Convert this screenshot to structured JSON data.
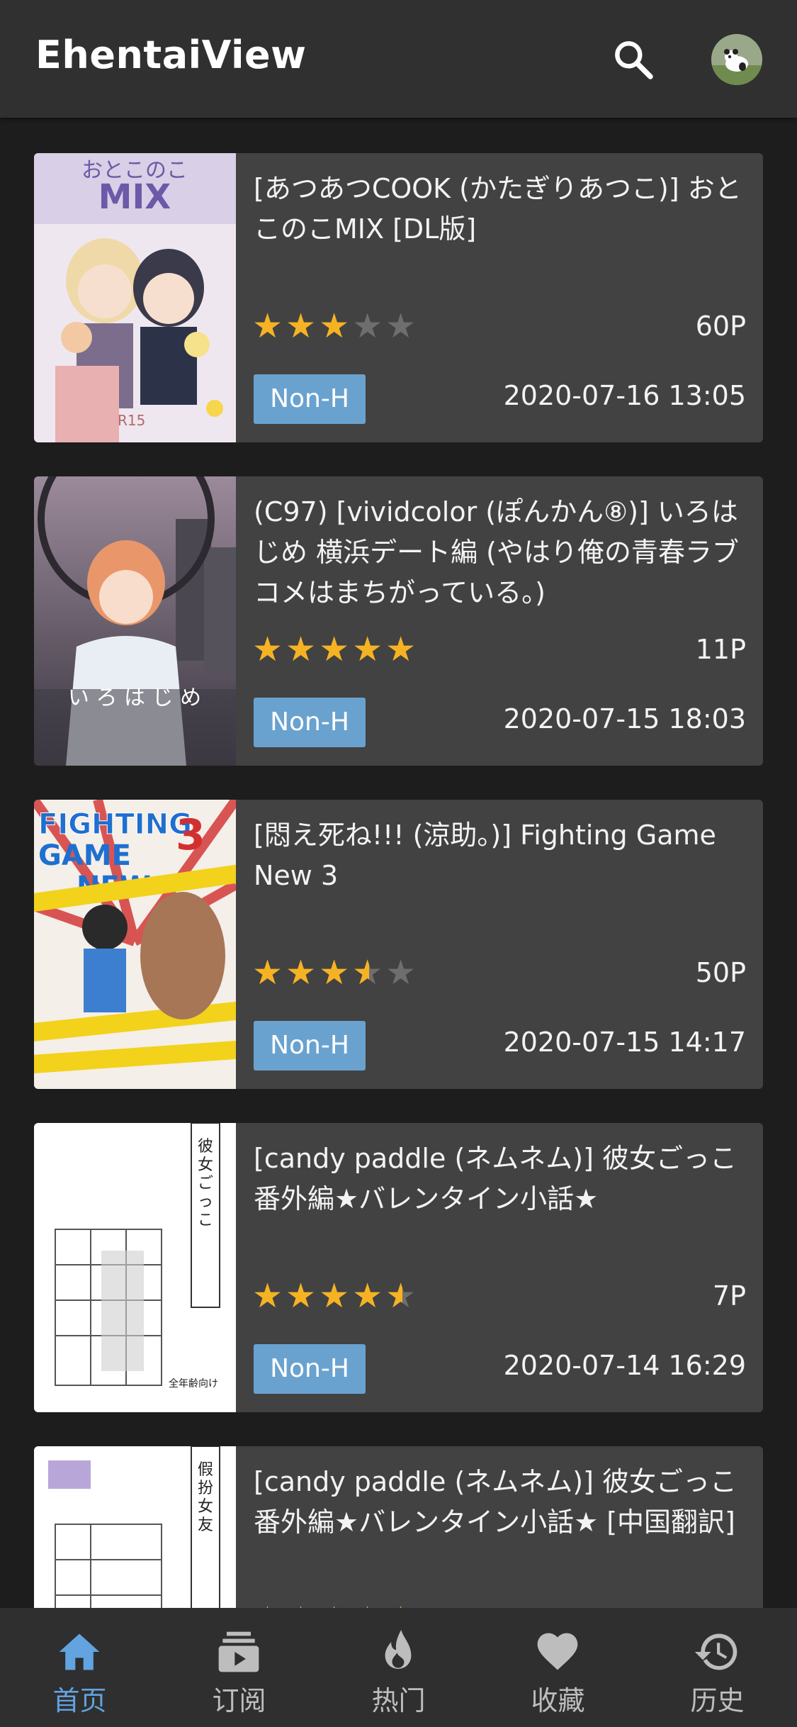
{
  "app": {
    "title": "EhentaiView",
    "actions": [
      "search-icon",
      "avatar"
    ]
  },
  "colors": {
    "accent": "#62a3e0",
    "badge": "#6aa2cf",
    "star": "#f5b324",
    "card": "#424242",
    "background": "#1d1d1d"
  },
  "gallery": [
    {
      "title": "[あつあつCOOK (かたぎりあつこ)] おとこのこMIX [DL版]",
      "rating": 3,
      "pages": "60P",
      "category": "Non-H",
      "date": "2020-07-16 13:05"
    },
    {
      "title": "(C97) [vividcolor (ぽんかん⑧)] いろはじめ 横浜デート編 (やはり俺の青春ラブコメはまちがっている。)",
      "rating": 5,
      "pages": "11P",
      "category": "Non-H",
      "date": "2020-07-15 18:03"
    },
    {
      "title": "[悶え死ね!!! (涼助。)] Fighting Game New 3",
      "rating": 3.5,
      "pages": "50P",
      "category": "Non-H",
      "date": "2020-07-15 14:17"
    },
    {
      "title": "[candy paddle (ネムネム)] 彼女ごっこ 番外編★バレンタイン小話★",
      "rating": 4.5,
      "pages": "7P",
      "category": "Non-H",
      "date": "2020-07-14 16:29"
    },
    {
      "title": "[candy paddle (ネムネム)] 彼女ごっこ 番外編★バレンタイン小話★ [中国翻訳]",
      "rating": 5,
      "pages": "",
      "category": "",
      "date": ""
    }
  ],
  "nav": [
    {
      "label": "首页",
      "icon": "home-icon",
      "active": true
    },
    {
      "label": "订阅",
      "icon": "subscriptions-icon",
      "active": false
    },
    {
      "label": "热门",
      "icon": "whatshot-icon",
      "active": false
    },
    {
      "label": "收藏",
      "icon": "favorite-icon",
      "active": false
    },
    {
      "label": "历史",
      "icon": "history-icon",
      "active": false
    }
  ]
}
